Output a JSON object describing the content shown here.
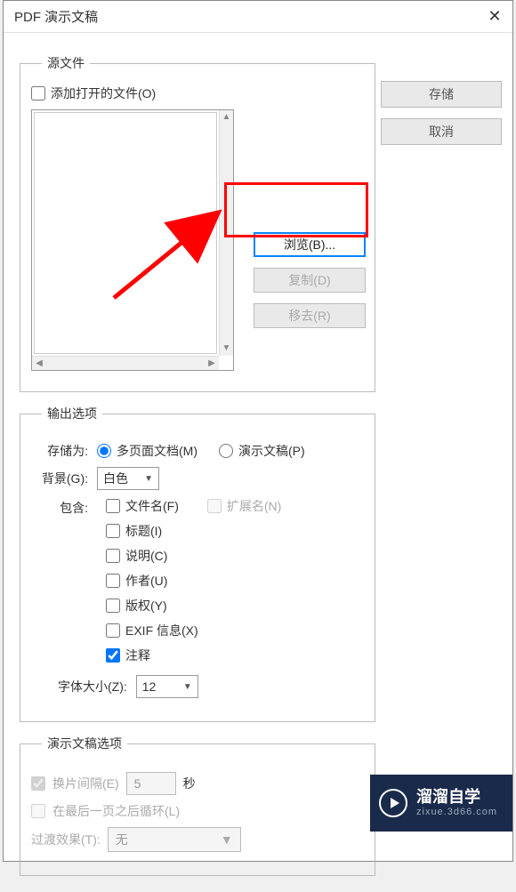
{
  "title": "PDF 演示文稿",
  "side": {
    "save": "存储",
    "cancel": "取消"
  },
  "source": {
    "legend": "源文件",
    "addOpen": "添加打开的文件(O)",
    "browse": "浏览(B)...",
    "duplicate": "复制(D)",
    "remove": "移去(R)"
  },
  "output": {
    "legend": "输出选项",
    "saveAsLabel": "存储为:",
    "multiPage": "多页面文档(M)",
    "presentation": "演示文稿(P)",
    "bgLabel": "背景(G):",
    "bgValue": "白色",
    "includeLabel": "包含:",
    "filename": "文件名(F)",
    "extension": "扩展名(N)",
    "titleField": "标题(I)",
    "description": "说明(C)",
    "author": "作者(U)",
    "copyright": "版权(Y)",
    "exif": "EXIF 信息(X)",
    "notes": "注释",
    "fontSizeLabel": "字体大小(Z):",
    "fontSize": "12"
  },
  "presentation": {
    "legend": "演示文稿选项",
    "interval": "换片间隔(E)",
    "intervalVal": "5",
    "seconds": "秒",
    "loop": "在最后一页之后循环(L)",
    "transitionLabel": "过渡效果(T):",
    "transitionVal": "无"
  },
  "watermark": {
    "name": "溜溜自学",
    "sub": "zixue.3d66.com"
  },
  "urlFaint": ""
}
